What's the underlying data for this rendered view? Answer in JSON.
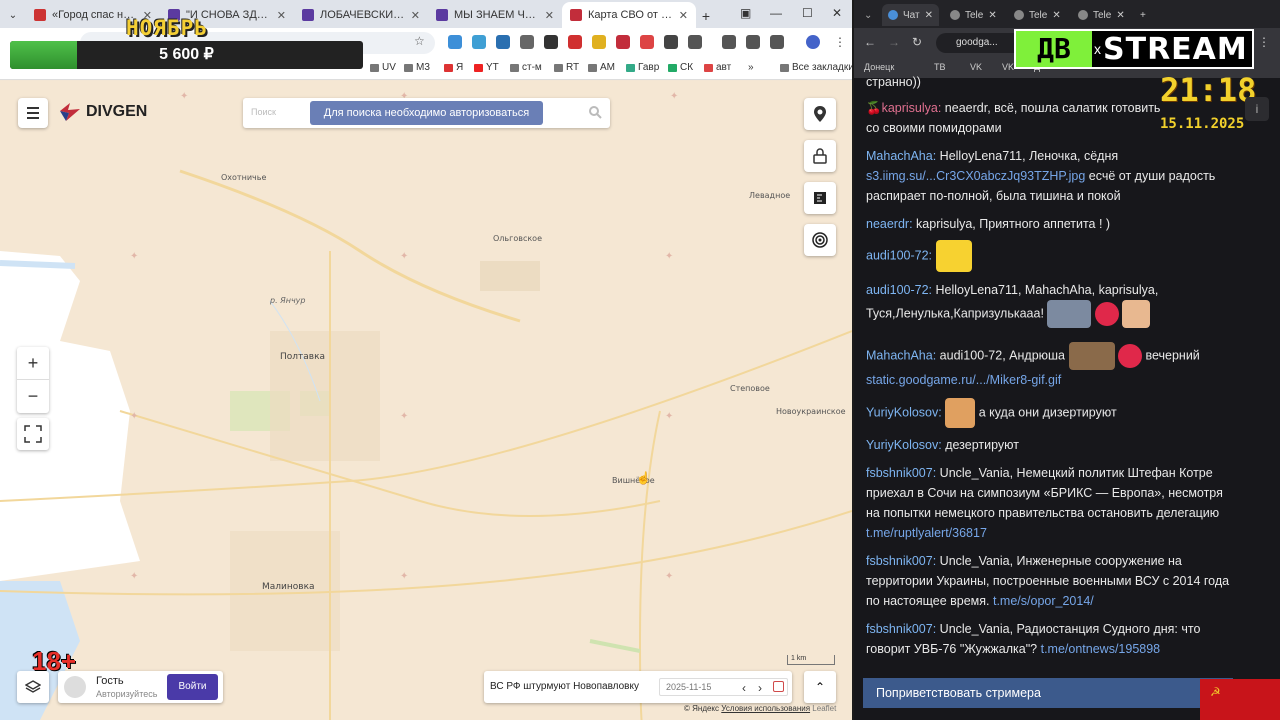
{
  "browser_left": {
    "tabs": [
      {
        "title": "«Город спас нас, теперь"
      },
      {
        "title": "\"И СНОВА ЗДРАВСТВУЙ"
      },
      {
        "title": "ЛОБАЧЕВСКИЙ, ДРОНЫ"
      },
      {
        "title": "МЫ ЗНАЕМ ЧТО НУЖНО"
      },
      {
        "title": "Карта СВО от канала DI"
      }
    ],
    "bookmarks": [
      "UV",
      "M3",
      "Я",
      "YT",
      "ст-м",
      "RT",
      "AM",
      "Гавр",
      "СК",
      "авт",
      "Все закладки"
    ]
  },
  "overlay": {
    "month": "НОЯБРЬ",
    "donation_amount": "5 600 ₽",
    "donation_progress": 0.19,
    "age_rating": "18+"
  },
  "map": {
    "brand": "DIVGEN",
    "search_placeholder": "Поиск",
    "auth_notice": "Для поиска необходимо авторизоваться",
    "places": {
      "ohotnichye": "Охотничье",
      "olgovskoe": "Ольговское",
      "levadnoe": "Левадное",
      "river": "р. Янчур",
      "poltavka": "Полтавка",
      "stepovoe": "Степовое",
      "novoukrainskoe": "Новоукраинское",
      "vishnevoe": "Вишнёвое",
      "malinovka": "Малиновка"
    },
    "zoom_in": "+",
    "zoom_out": "−",
    "guest_name": "Гость",
    "guest_status": "Авторизуйтесь",
    "login_label": "Войти",
    "news_title": "ВС РФ штурмуют Новопавловку",
    "news_date": "2025-11-15",
    "scale": "1 km",
    "attribution_prefix": "© Яндекс",
    "attribution_link": "Условия использования",
    "leaflet": "Leaflet"
  },
  "browser_right": {
    "tabs": [
      {
        "title": "Чат"
      },
      {
        "title": "Tele"
      },
      {
        "title": "Tele"
      },
      {
        "title": "Tele"
      }
    ],
    "url": "goodga...",
    "bookmarks": [
      "Донецк",
      "ТВ",
      "VK",
      "VK",
      "Д"
    ]
  },
  "stream_logo": {
    "left": "ДВ",
    "x": "x",
    "right": "STREAM"
  },
  "clock": {
    "time": "21:18",
    "date": "15.11.2025"
  },
  "chat": {
    "messages": [
      {
        "user": "",
        "text": "странно))"
      },
      {
        "user": "kaprisulya:",
        "text": " neaerdr, всё, пошла салатик готовить со своими помидорами"
      },
      {
        "user": "MahachAha:",
        "text": " HelloyLena711, Леночка, сёдня ",
        "link": "s3.iimg.su/...Cr3CX0abczJq93TZHP.jpg",
        "text2": " есчё от души радость распирает по-полной, была тишина и покой"
      },
      {
        "user": "neaerdr:",
        "text": " kaprisulya, Приятного аппетита ! )"
      },
      {
        "user": "audi100-72:",
        "text": ""
      },
      {
        "user": "audi100-72:",
        "text": " HelloyLena711, MahachAha, kaprisulya, Туся,Ленулька,Капризулькааа!"
      },
      {
        "user": "MahachAha:",
        "text": " audi100-72, Андрюша",
        "text2": " вечерний",
        "link": "static.goodgame.ru/.../Miker8-gif.gif"
      },
      {
        "user": "YuriyKolosov:",
        "text": " а куда они дизертируют"
      },
      {
        "user": "YuriyKolosov:",
        "text": " дезертируют"
      },
      {
        "user": "fsbshnik007:",
        "text": " Uncle_Vania, Немецкий политик Штефан Котре приехал в Сочи на симпозиум «БРИКС — Европа», несмотря на попытки немецкого правительства остановить делегацию ",
        "link": "t.me/ruptlyalert/36817"
      },
      {
        "user": "fsbshnik007:",
        "text": " Uncle_Vania, Инженерные сооружение на территории Украины, построенные военными ВСУ с 2014 года по настоящее время. ",
        "link": "t.me/s/opor_2014/"
      },
      {
        "user": "fsbshnik007:",
        "text": " Uncle_Vania, Радиостанция Судного дня: что говорит УВБ-76 \"Жужжалка\"? ",
        "link": "t.me/ontnews/195898"
      }
    ],
    "greet_button": "Поприветствовать стримера"
  }
}
